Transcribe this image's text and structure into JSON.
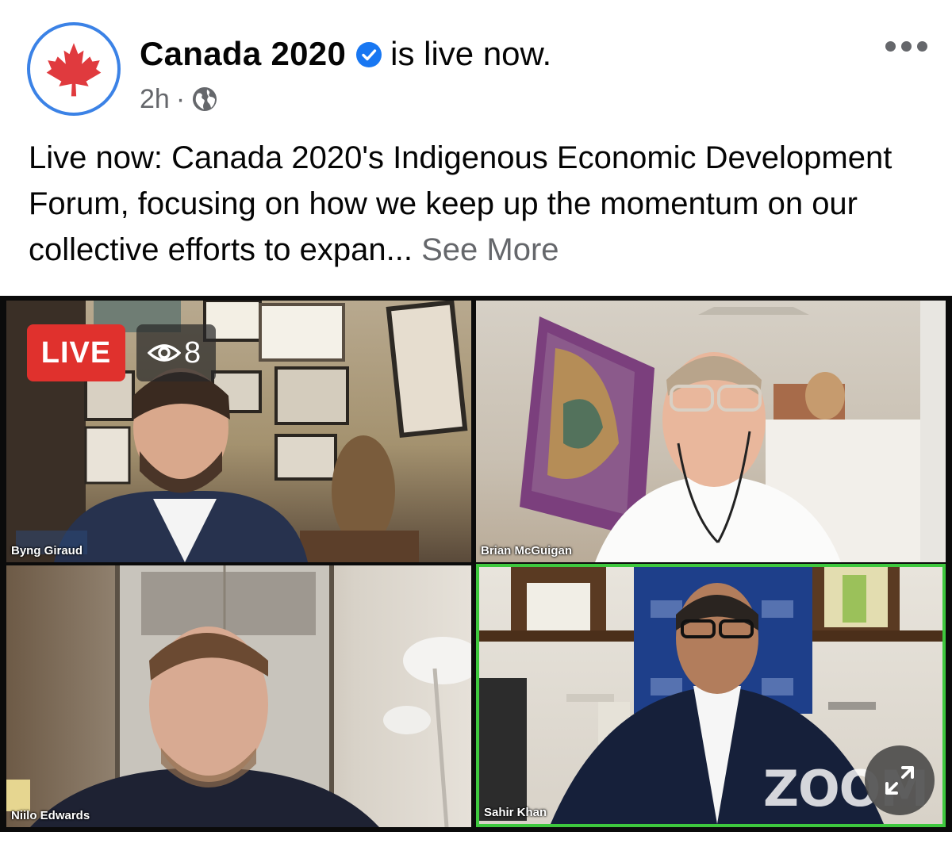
{
  "post": {
    "author": "Canada 2020",
    "status_suffix": "is live now.",
    "time": "2h",
    "separator": "·",
    "audience_icon": "globe-icon",
    "verified_icon": "verified-badge-icon",
    "more_icon": "more-options-icon",
    "text": "Live now: Canada 2020's Indigenous Economic Development Forum, focusing on how we keep up the momentum on our collective efforts to expan...",
    "see_more": "See More"
  },
  "video": {
    "live_label": "LIVE",
    "viewer_icon": "eye-icon",
    "viewer_count": "8",
    "participants": [
      {
        "name": "Byng Giraud"
      },
      {
        "name": "Brian McGuigan"
      },
      {
        "name": "Niilo Edwards"
      },
      {
        "name": "Sahir Khan"
      }
    ],
    "watermark": "ZOOM",
    "expand_icon": "expand-arrows-icon"
  },
  "colors": {
    "live_red": "#e0312d",
    "verified_blue": "#1877f2",
    "avatar_ring": "#3b82e6",
    "maple_red": "#e03a3e",
    "active_speaker_border": "#3ec83e",
    "secondary_text": "#65676b"
  }
}
